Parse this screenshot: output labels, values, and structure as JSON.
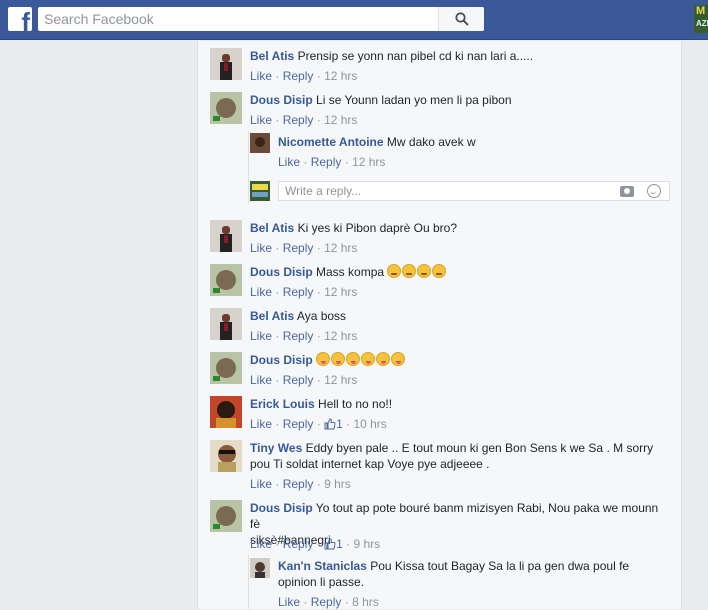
{
  "header": {
    "logo": "f",
    "search_placeholder": "Search Facebook",
    "corner_badge_line1": "M",
    "corner_badge_line2": "AZI"
  },
  "comments": [
    {
      "name": "Bel Atis",
      "text": "Prensip se yonn nan pibel cd ki nan lari a.....",
      "like": "Like",
      "reply": "Reply",
      "time": "12 hrs"
    },
    {
      "name": "Dous Disip",
      "text": "Li se Younn ladan yo men li pa pibon",
      "like": "Like",
      "reply": "Reply",
      "time": "12 hrs"
    },
    {
      "name": "Nicomette Antoine",
      "text": "Mw dako avek w",
      "like": "Like",
      "reply": "Reply",
      "time": "12 hrs"
    },
    {
      "name": "Bel Atis",
      "text": "Ki yes ki Pibon daprè Ou bro?",
      "like": "Like",
      "reply": "Reply",
      "time": "12 hrs"
    },
    {
      "name": "Dous Disip",
      "text": "Mass kompa",
      "like": "Like",
      "reply": "Reply",
      "time": "12 hrs"
    },
    {
      "name": "Bel Atis",
      "text": "Aya boss",
      "like": "Like",
      "reply": "Reply",
      "time": "12 hrs"
    },
    {
      "name": "Dous Disip",
      "text": "",
      "like": "Like",
      "reply": "Reply",
      "time": "12 hrs"
    },
    {
      "name": "Erick Louis",
      "text": "Hell to no no!!",
      "like": "Like",
      "reply": "Reply",
      "likes": "1",
      "time": "10 hrs"
    },
    {
      "name": "Tiny Wes",
      "text": "Eddy byen pale .. E tout moun ki gen Bon Sens k we Sa . M sorry",
      "text2": "pou Ti soldat internet kap Voye pye adjeeee .",
      "like": "Like",
      "reply": "Reply",
      "time": "9 hrs"
    },
    {
      "name": "Dous Disip",
      "text": "Yo tout ap pote bouré banm mizisyen Rabi, Nou paka we mounn fè",
      "text2": "siksè#bannegri",
      "like": "Like",
      "reply": "Reply",
      "likes": "1",
      "time": "9 hrs"
    },
    {
      "name": "Kan'n Staniclas",
      "text": "Pou Kissa tout Bagay Sa la li pa gen dwa poul fe",
      "text2": "opinion li passe.",
      "like": "Like",
      "reply": "Reply",
      "time": "8 hrs"
    }
  ],
  "reply_box": {
    "placeholder": "Write a reply..."
  },
  "separator": "·",
  "colors": {
    "brand": "#3b5998",
    "link": "#365899",
    "meta": "#90949c",
    "background": "#e9ebee"
  }
}
